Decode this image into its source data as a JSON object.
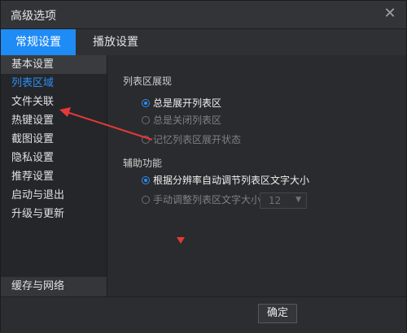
{
  "window": {
    "title": "高级选项"
  },
  "tabs": [
    {
      "label": "常规设置"
    },
    {
      "label": "播放设置"
    }
  ],
  "sidebar": {
    "items": [
      {
        "label": "基本设置"
      },
      {
        "label": "列表区域"
      },
      {
        "label": "文件关联"
      },
      {
        "label": "热键设置"
      },
      {
        "label": "截图设置"
      },
      {
        "label": "隐私设置"
      },
      {
        "label": "推荐设置"
      },
      {
        "label": "启动与退出"
      },
      {
        "label": "升级与更新"
      }
    ],
    "bottom_item": "缓存与网络"
  },
  "list_display": {
    "title": "列表区展现",
    "options": [
      {
        "label": "总是展开列表区",
        "selected": true
      },
      {
        "label": "总是关闭列表区",
        "selected": false
      },
      {
        "label": "记忆列表区展开状态",
        "selected": false
      }
    ]
  },
  "assist": {
    "title": "辅助功能",
    "options": [
      {
        "label": "根据分辨率自动调节列表区文字大小",
        "selected": true
      },
      {
        "label": "手动调整列表区文字大小",
        "selected": false
      }
    ],
    "font_size_value": "12"
  },
  "footer": {
    "ok_label": "确定"
  },
  "colors": {
    "accent": "#1f8bf5",
    "annotation": "#e53935"
  },
  "icons": {
    "close": "close-icon",
    "dropdown": "chevron-down-icon",
    "radio": "radio-icon"
  }
}
